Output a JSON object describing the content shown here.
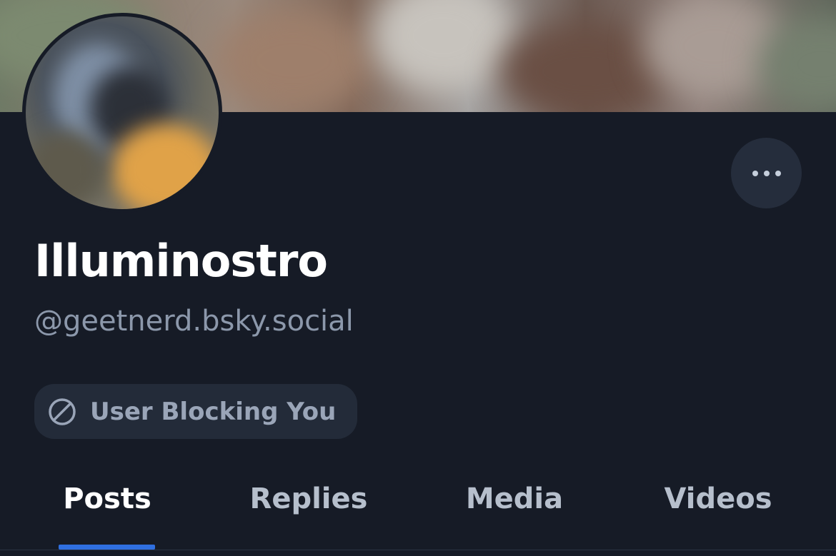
{
  "profile": {
    "display_name": "Illuminostro",
    "handle": "@geetnerd.bsky.social",
    "status_badge": "User Blocking You",
    "status_icon": "block-icon"
  },
  "actions": {
    "more_icon": "ellipsis-icon"
  },
  "tabs": [
    {
      "label": "Posts",
      "active": true
    },
    {
      "label": "Replies",
      "active": false
    },
    {
      "label": "Media",
      "active": false
    },
    {
      "label": "Videos",
      "active": false
    }
  ],
  "colors": {
    "background": "#161b26",
    "badge_background": "#232b39",
    "tab_indicator": "#2f6fe0",
    "secondary_text": "#8c98ab"
  }
}
